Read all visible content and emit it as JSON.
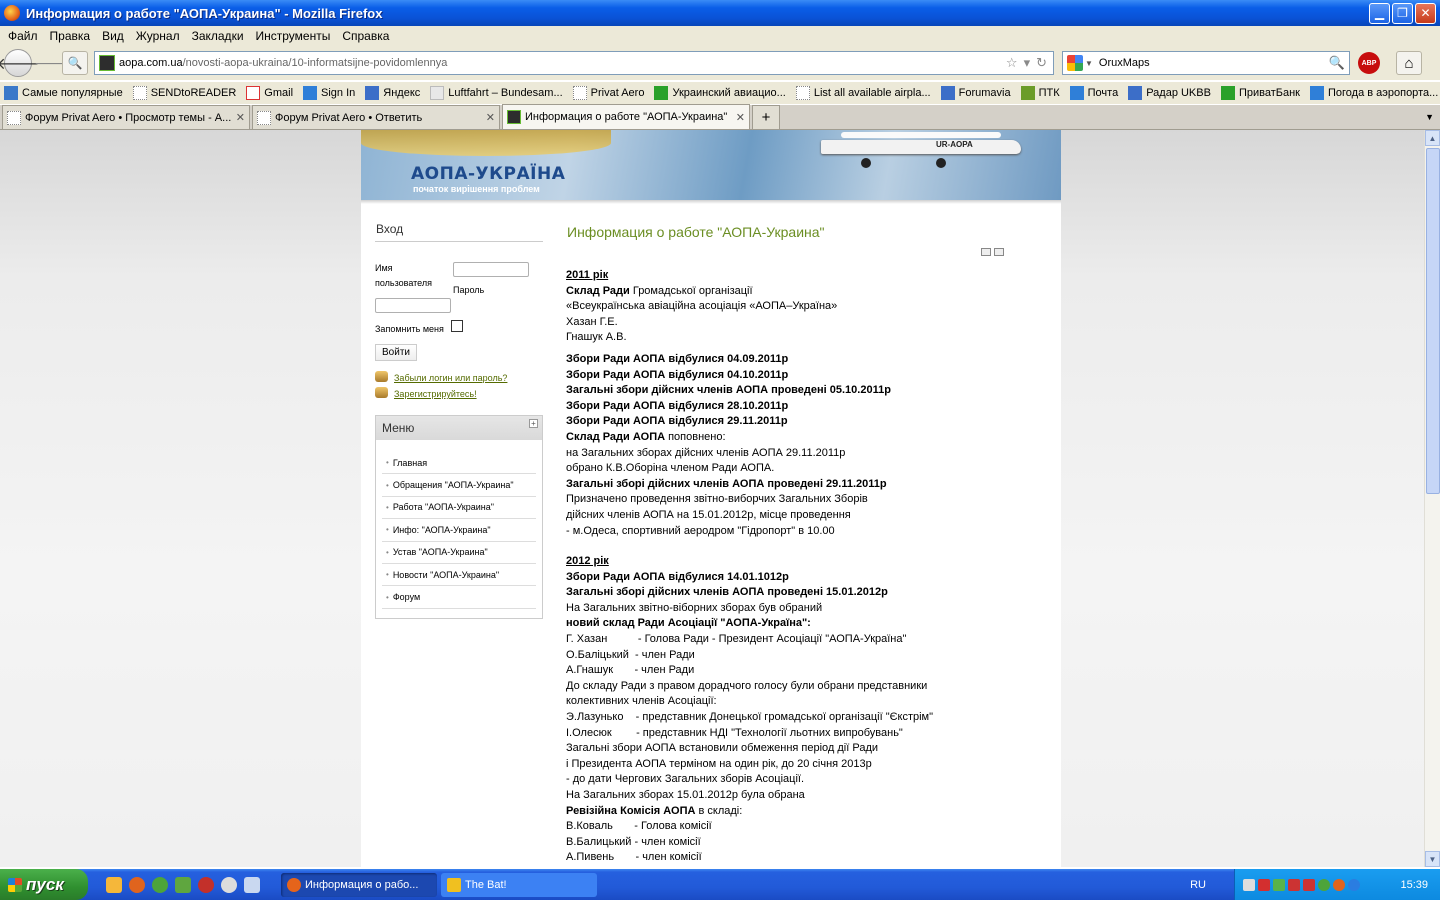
{
  "window": {
    "title": "Информация о работе \"АОПА-Украина\" - Mozilla Firefox"
  },
  "menubar": [
    "Файл",
    "Правка",
    "Вид",
    "Журнал",
    "Закладки",
    "Инструменты",
    "Справка"
  ],
  "navbar": {
    "url_host": "aopa.com.ua",
    "url_path": "/novosti-aopa-ukraina/10-informatsijne-povidomlennya",
    "search_value": "OruxMaps",
    "abp_label": "ABP"
  },
  "bookmarks": [
    "Самые популярные",
    "SENDtoREADER",
    "Gmail",
    "Sign In",
    "Яндекс",
    "Luftfahrt – Bundesam...",
    "Privat Aero",
    "Украинский авиацио...",
    "List all available airpla...",
    "Forumavia",
    "ПТК",
    "Почта",
    "Радар UKBB",
    "ПриватБанк",
    "Погода в аэропорта..."
  ],
  "tabs": [
    {
      "label": "Форум Privat Aero • Просмотр темы - А..."
    },
    {
      "label": "Форум Privat Aero • Ответить"
    },
    {
      "label": "Информация о работе \"АОПА-Украина\""
    }
  ],
  "banner": {
    "logo": "АОПА-УКРАЇНА",
    "slogan": "початок вирішення проблем",
    "aircraft_reg": "UR-AOPA"
  },
  "login": {
    "title": "Вход",
    "username_label_1": "Имя",
    "username_label_2": "пользователя",
    "password_label": "Пароль",
    "remember_label": "Запомнить меня",
    "submit": "Войти",
    "forgot_link": "Забыли логин или пароль?",
    "register_link": "Зарегистрируйтесь!"
  },
  "menu": {
    "title": "Меню",
    "items": [
      "Главная",
      "Обращения \"АОПА-Украина\"",
      "Работа \"АОПА-Украина\"",
      "Инфо: \"АОПА-Украина\"",
      "Устав \"АОПА-Украина\"",
      "Новости \"АОПА-Украина\"",
      "Форум"
    ]
  },
  "article": {
    "title": "Информация о работе \"АОПА-Украина\"",
    "year_2011": "2011 рік",
    "l1_b": "Склад Ради",
    "l1_t": " Громадської організації",
    "l2": "«Всеукраїнська авіаційна асоціація «АОПА–Україна»",
    "l3": "Хазан Г.Е.",
    "l4": "Гнашук А.В.",
    "m1": "Збори Ради АОПА відбулися 04.09.2011р",
    "m2": "Збори Ради АОПА відбулися 04.10.2011р",
    "m3": "Загальні збори дійсних членів АОПА проведені 05.10.2011р",
    "m4": "Збори Ради АОПА відбулися 28.10.2011р",
    "m5": "Збори Ради АОПА відбулися 29.11.2011р",
    "m6_b": "Склад Ради АОПА",
    "m6_t": " поповнено:",
    "m7": "на Загальних зборах дійсних членів АОПА 29.11.2011р",
    "m8": "обрано К.В.Оборіна членом Ради АОПА.",
    "m9": "Загальні зборі дійсних членів АОПА проведені 29.11.2011р",
    "m10": "Призначено проведення звітно-виборчих Загальних Зборів",
    "m11": "дійсних членів АОПА на 15.01.2012р, місце проведення",
    "m12": "- м.Одеса, спортивний аеродром \"Гідропорт\" в 10.00",
    "year_2012": "2012 рік",
    "n1": "Збори Ради АОПА відбулися 14.01.1012р",
    "n2": "Загальні зборі дійсних членів АОПА проведені 15.01.2012р",
    "n3": "На Загальних звітно-віборних зборах був обраний",
    "n4": "новий склад Ради Асоціації \"АОПА-Україна\":",
    "n5": "Г. Хазан          - Голова Ради - Президент Асоціації \"АОПА-Україна\"",
    "n6": "О.Баліцький  - член Ради",
    "n7": "А.Гнашук       - член Ради",
    "n8": "До складу Ради з правом дорадчого голосу були обрани представники",
    "n9": "колективних членів Асоціації:",
    "n10": "Э.Лазунько    - представник Донецької громадської організації \"Єкстрім\"",
    "n11": "І.Олесюк        - представник НДІ \"Технології льотних випробувань\"",
    "n12": "Загальні збори АОПА встановили обмеження період дії Ради",
    "n13": "і Президента АОПА терміном на один рік, до 20 січня 2013р",
    "n14": "- до дати Чергових Загальних зборів Асоціації.",
    "n15": "На Загальних зборах 15.01.2012р була обрана",
    "n16_b": "Ревізійна Комісія АОПА",
    "n16_t": " в складі:",
    "n17": "В.Коваль       - Голова комісії",
    "n18": "В.Балицький - член комісії",
    "n19": "А.Пивень       - член комісії"
  },
  "taskbar": {
    "start": "пуск",
    "tasks": [
      "Информация о рабо...",
      "The Bat!"
    ],
    "lang": "RU",
    "clock": "15:39"
  },
  "colors": {
    "title_green": "#6b8e23",
    "link_green": "#556b00",
    "xp_blue": "#0a52d6"
  }
}
